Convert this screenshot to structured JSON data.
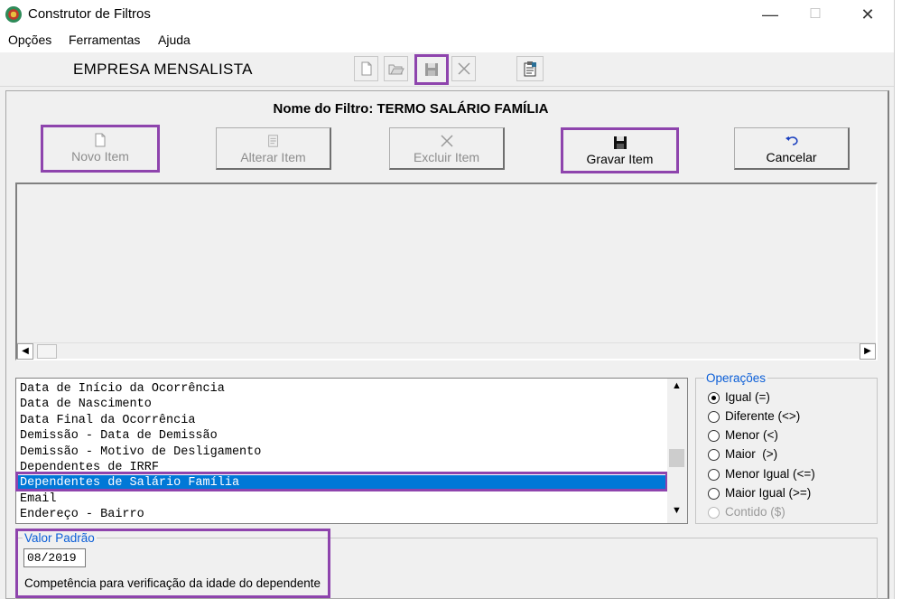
{
  "window": {
    "title": "Construtor de Filtros",
    "minimize": "—",
    "maximize": "☐",
    "close": "✕"
  },
  "menu": [
    "Opções",
    "Ferramentas",
    "Ajuda"
  ],
  "toolbar": {
    "company": "EMPRESA MENSALISTA"
  },
  "filter": {
    "label": "Nome do Filtro: TERMO SALÁRIO FAMÍLIA"
  },
  "buttons": {
    "novo": "Novo Item",
    "alterar": "Alterar Item",
    "excluir": "Excluir Item",
    "gravar": "Gravar Item",
    "cancelar": "Cancelar"
  },
  "fields": [
    "Data de Início da Ocorrência",
    "Data de Nascimento",
    "Data Final da Ocorrência",
    "Demissão - Data de Demissão",
    "Demissão - Motivo de Desligamento",
    "Dependentes de IRRF",
    "Dependentes de Salário Família",
    "Email",
    "Endereço - Bairro"
  ],
  "selected_field": "Dependentes de Salário Família",
  "operations": {
    "legend": "Operações",
    "options": [
      "Igual (=)",
      "Diferente (<>)",
      "Menor (<)",
      "Maior  (>)",
      "Menor Igual (<=)",
      "Maior Igual (>=)",
      "Contido ($)"
    ],
    "selected": "Igual (=)"
  },
  "valor_padrao": {
    "legend": "Valor Padrão",
    "value": "08/2019",
    "description": "Competência para verificação da idade do dependente"
  },
  "colors": {
    "highlight": "#8e44ad",
    "selection": "#0078d7",
    "legend": "#0b5ed7"
  }
}
